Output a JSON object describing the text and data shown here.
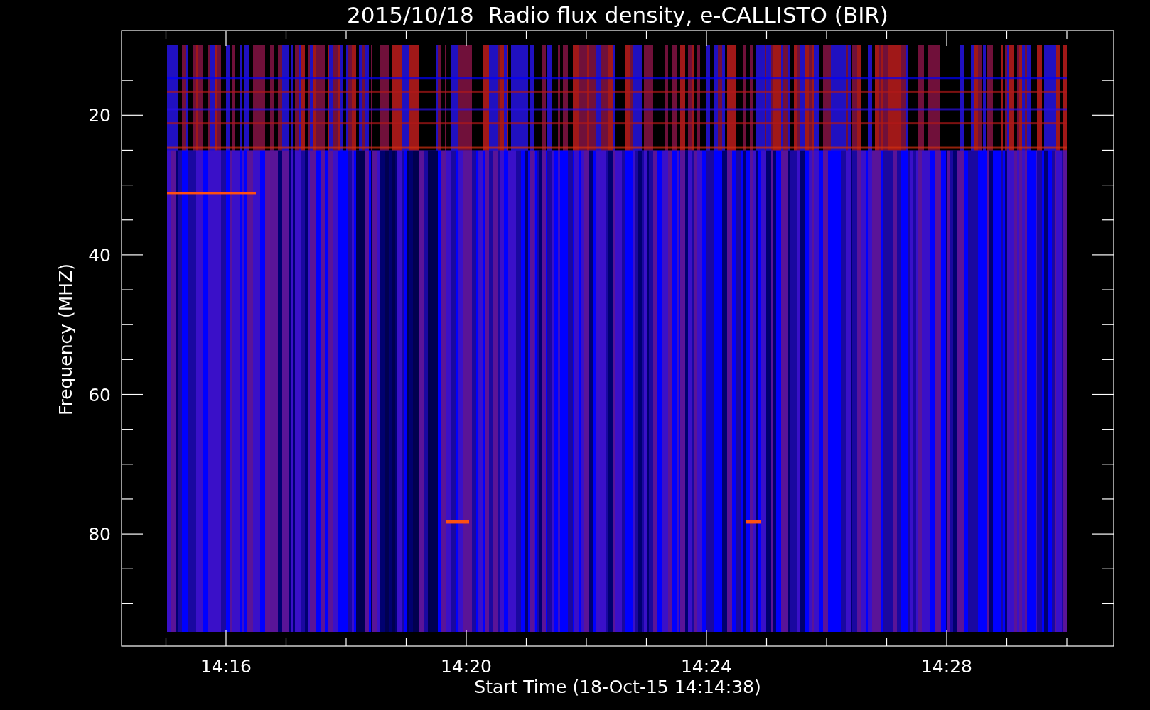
{
  "title": "2015/10/18  Radio flux density, e-CALLISTO (BIR)",
  "ylabel": "Frequency (MHZ)",
  "xlabel": "Start Time (18-Oct-15 14:14:38)",
  "yticks": [
    "20",
    "40",
    "60",
    "80"
  ],
  "xticks": [
    "14:16",
    "14:20",
    "14:24",
    "14:28"
  ]
}
